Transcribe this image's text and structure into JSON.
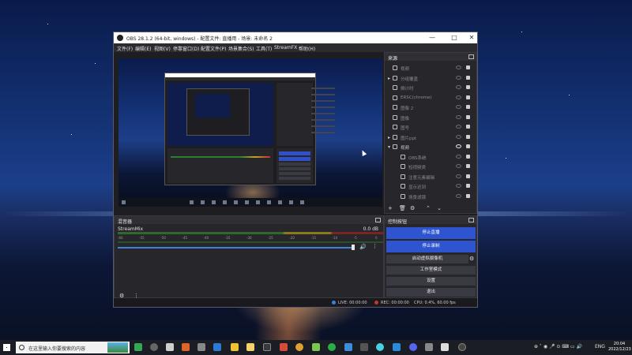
{
  "window": {
    "title": "OBS 28.1.2 (64-bit, windows) - 配置文件: 直播用 - 场景: 未命名 2",
    "controls": {
      "minimize": "—",
      "maximize": "□",
      "close": "✕"
    }
  },
  "menu": [
    "文件(F)",
    "编辑(E)",
    "视图(V)",
    "停靠窗口(D)",
    "配置文件(P)",
    "场景集合(S)",
    "工具(T)",
    "StreamFX",
    "帮助(H)"
  ],
  "sources": {
    "title": "来源",
    "items": [
      {
        "name": "视频",
        "icon": "audio-icon",
        "expandable": false,
        "visible": false
      },
      {
        "name": "分组覆盖",
        "icon": "folder-icon",
        "expandable": true,
        "visible": false
      },
      {
        "name": "倒计时",
        "icon": "timer-icon",
        "expandable": false,
        "visible": false
      },
      {
        "name": "ERSC(chrome)",
        "icon": "browser-icon",
        "expandable": false,
        "visible": false
      },
      {
        "name": "图像 2",
        "icon": "image-icon",
        "expandable": false,
        "visible": false
      },
      {
        "name": "图像",
        "icon": "image-icon",
        "expandable": false,
        "visible": false
      },
      {
        "name": "图号",
        "icon": "image-icon",
        "expandable": false,
        "visible": false
      },
      {
        "name": "图片ppt",
        "icon": "folder-icon",
        "expandable": true,
        "visible": false
      },
      {
        "name": "视频",
        "icon": "folder-icon",
        "expandable": true,
        "visible": true
      },
      {
        "name": "OBS系统",
        "icon": "play-icon",
        "expandable": false,
        "visible": false,
        "child": true
      },
      {
        "name": "短视频类",
        "icon": "play-icon",
        "expandable": false,
        "visible": false,
        "child": true
      },
      {
        "name": "注意元素编辑",
        "icon": "play-icon",
        "expandable": false,
        "visible": false,
        "child": true
      },
      {
        "name": "显示迟到",
        "icon": "play-icon",
        "expandable": false,
        "visible": false,
        "child": true
      },
      {
        "name": "场景滤镜",
        "icon": "play-icon",
        "expandable": false,
        "visible": false,
        "child": true
      }
    ],
    "toolbar": [
      "+",
      "🗑",
      "⚙",
      "⌃",
      "⌄"
    ]
  },
  "mixer": {
    "title": "混音器",
    "channel": "StreamMix",
    "db": "0.0 dB",
    "scale": [
      "-60",
      "-55",
      "-50",
      "-45",
      "-40",
      "-35",
      "-30",
      "-25",
      "-20",
      "-15",
      "-10",
      "-5",
      "0"
    ]
  },
  "controls": {
    "title": "控制按钮",
    "stop_stream": "停止直播",
    "stop_record": "停止录制",
    "virtual_cam": "启动虚拟摄像机",
    "studio_mode": "工作室模式",
    "settings": "设置",
    "exit": "退出"
  },
  "status": {
    "live": "LIVE: 00:00:00",
    "rec": "REC: 00:00:00",
    "cpu": "CPU: 0.4%, 60.00 fps"
  },
  "taskbar": {
    "search_placeholder": "在这里输入你要搜索的内容",
    "lang": "ENG",
    "time": "20:04",
    "date": "2022/12/23"
  },
  "colors": {
    "accent": "#2e55cf",
    "live_dot": "#3b82d8",
    "rec_dot": "#c0392b"
  }
}
